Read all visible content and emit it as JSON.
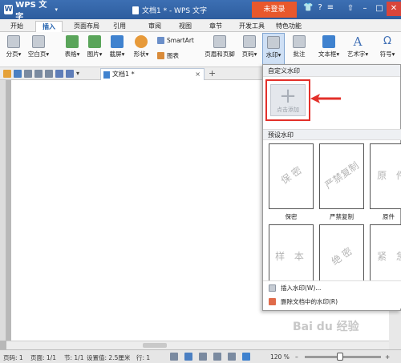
{
  "titlebar": {
    "app_name": "WPS 文字",
    "document_title": "文档1 * - WPS 文字",
    "login_button": "未登录",
    "icons": [
      "shirt-icon",
      "help-icon",
      "menu-icon"
    ]
  },
  "menu": {
    "tabs": [
      "开始",
      "插入",
      "页面布局",
      "引用",
      "审阅",
      "视图",
      "章节",
      "开发工具",
      "特色功能"
    ],
    "active": "插入"
  },
  "ribbon": {
    "page_break": "分页",
    "blank_page": "空白页",
    "table": "表格",
    "picture": "图片",
    "screenshot": "截屏",
    "shape": "形状",
    "smartart": "SmartArt",
    "chart": "图表",
    "header_footer": "页眉和页脚",
    "page_number": "页码",
    "watermark": "水印",
    "comment": "批注",
    "textbox": "文本框",
    "wordart": "艺术字",
    "symbol": "符号"
  },
  "document_tab": {
    "name": "文档1 *",
    "close": "×",
    "new_tab": "+"
  },
  "watermark_panel": {
    "custom_header": "自定义水印",
    "add_label": "点击添加",
    "preset_header": "预设水印",
    "presets": [
      {
        "preview": "保 密",
        "label": "保密"
      },
      {
        "preview": "严禁复制",
        "label": "严禁复制"
      },
      {
        "preview": "原 件",
        "label": "原件"
      },
      {
        "preview": "样 本",
        "label": "样本"
      },
      {
        "preview": "绝 密",
        "label": ""
      },
      {
        "preview": "紧 急",
        "label": ""
      }
    ],
    "actions": {
      "insert": "插入水印(W)...",
      "delete": "删除文档中的水印(R)"
    },
    "highlight_color": "#e3302a"
  },
  "statusbar": {
    "page_num": "页码: 1",
    "pages": "页面: 1/1",
    "section": "节: 1/1",
    "setting": "设置值: 2.5厘米",
    "row": "行: 1",
    "zoom": "120 %"
  },
  "site_watermark": "Bai du 经验"
}
